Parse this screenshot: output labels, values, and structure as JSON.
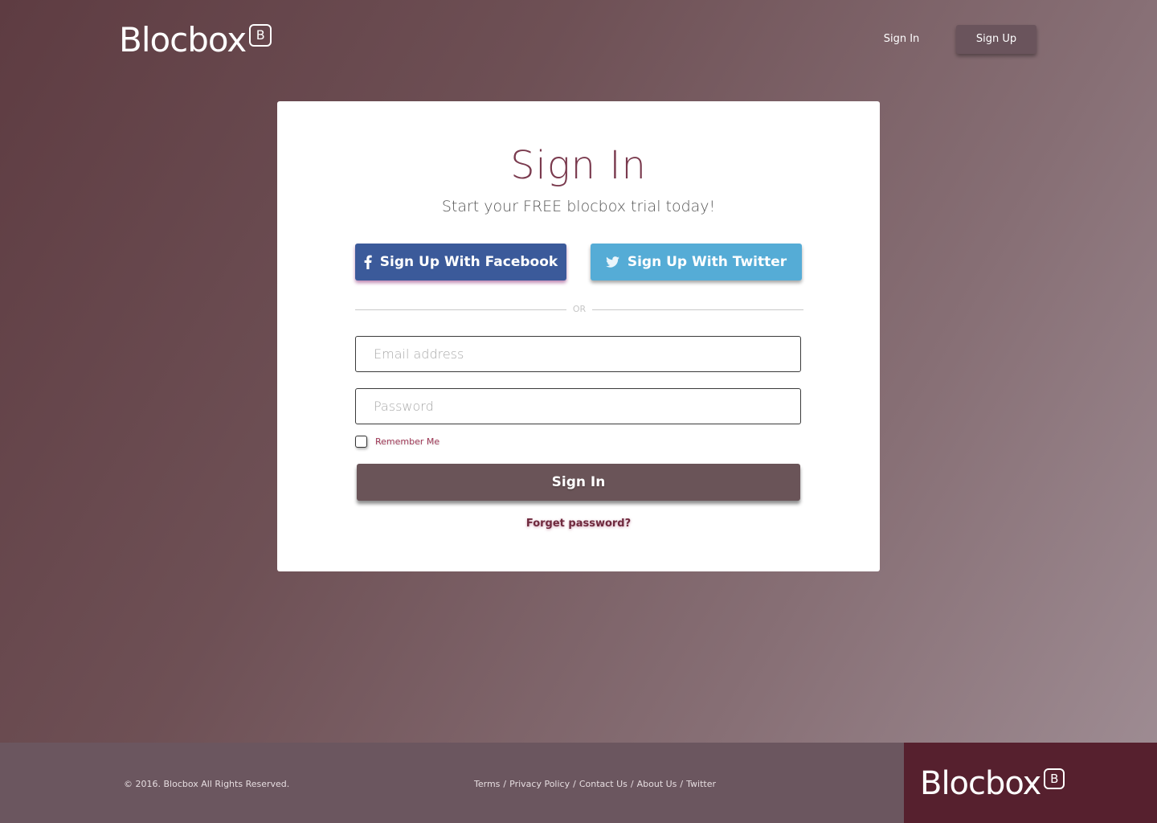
{
  "header": {
    "logo_text": "Blocbox",
    "logo_badge": "B",
    "signin_label": "Sign In",
    "signup_label": "Sign Up"
  },
  "card": {
    "title": "Sign In",
    "subtitle": "Start your FREE blocbox trial today!",
    "facebook_label": "Sign Up With Facebook",
    "twitter_label": "Sign Up With Twitter",
    "divider_text": "OR",
    "email_placeholder": "Email address",
    "password_placeholder": "Password",
    "remember_label": "Remember Me",
    "submit_label": "Sign In",
    "forgot_label": "Forget password?"
  },
  "footer": {
    "copyright": "© 2016. Blocbox All Rights Reserved.",
    "links": [
      "Terms",
      "Privacy Policy",
      "Contact Us",
      "About Us",
      "Twitter"
    ],
    "separator": "/",
    "logo_text": "Blocbox",
    "logo_badge": "B"
  },
  "colors": {
    "facebook": "#3b5a9a",
    "twitter": "#55acd6",
    "primary_button": "#6a5458",
    "title": "#7a3a4e",
    "footer_brand": "#56202e"
  },
  "icons": {
    "facebook": "facebook-icon",
    "twitter": "twitter-icon"
  }
}
